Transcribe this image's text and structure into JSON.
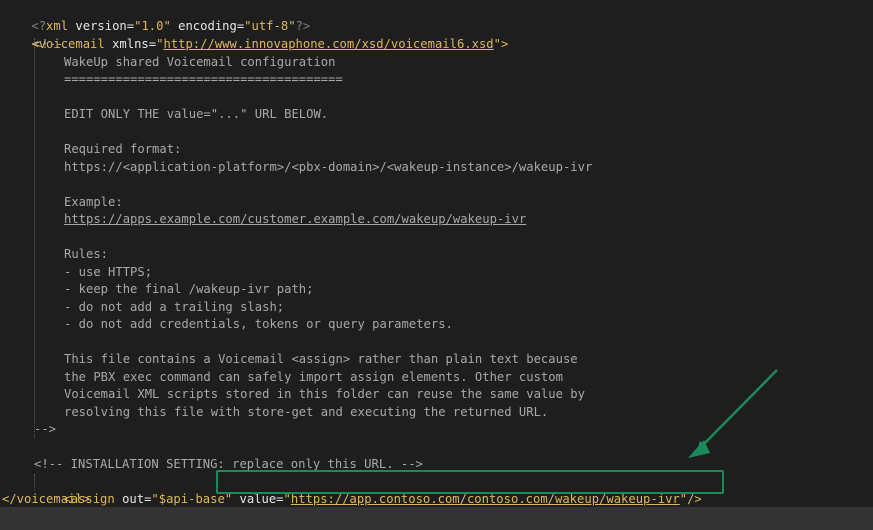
{
  "colors": {
    "background": "#1e1e1e",
    "tag": "#e0b85a",
    "comment": "#a8a8a8",
    "highlight": "#1a8a5a"
  },
  "code": {
    "xml_decl": {
      "open": "<?",
      "name": "xml",
      "attr1": " version=",
      "val1": "\"1.0\"",
      "attr2": " encoding=",
      "val2": "\"utf-8\"",
      "close": "?>"
    },
    "root_open": {
      "tag": "<voicemail",
      "attr": " xmlns=",
      "q1": "\"",
      "url": "http://www.innovaphone.com/xsd/voicemail6.xsd",
      "q2": "\"",
      "end": ">"
    },
    "comment_open": "<!--",
    "comment_lines": [
      "WakeUp shared Voicemail configuration",
      "======================================",
      "",
      "EDIT ONLY THE value=\"...\" URL BELOW.",
      "",
      "Required format:",
      "https://<application-platform>/<pbx-domain>/<wakeup-instance>/wakeup-ivr",
      "",
      "Example:",
      "",
      "",
      "Rules:",
      "- use HTTPS;",
      "- keep the final /wakeup-ivr path;",
      "- do not add a trailing slash;",
      "- do not add credentials, tokens or query parameters.",
      "",
      "This file contains a Voicemail <assign> rather than plain text because",
      "the PBX exec command can safely import assign elements. Other custom",
      "Voicemail XML scripts stored in this folder can reuse the same value by",
      "resolving this file with store-get and executing the returned URL."
    ],
    "example_url": "https://apps.example.com/customer.example.com/wakeup/wakeup-ivr",
    "comment_close": "-->",
    "install_comment": "<!-- INSTALLATION SETTING: replace only this URL. -->",
    "assign": {
      "tag": "<assign",
      "attr1": " out=",
      "val1": "\"$api-base\"",
      "attr2": " value=",
      "q1": "\"",
      "url": "https://app.contoso.com/contoso.com/wakeup/wakeup-ivr",
      "q2": "\"",
      "end": "/>"
    },
    "root_close": "</voicemail>"
  }
}
